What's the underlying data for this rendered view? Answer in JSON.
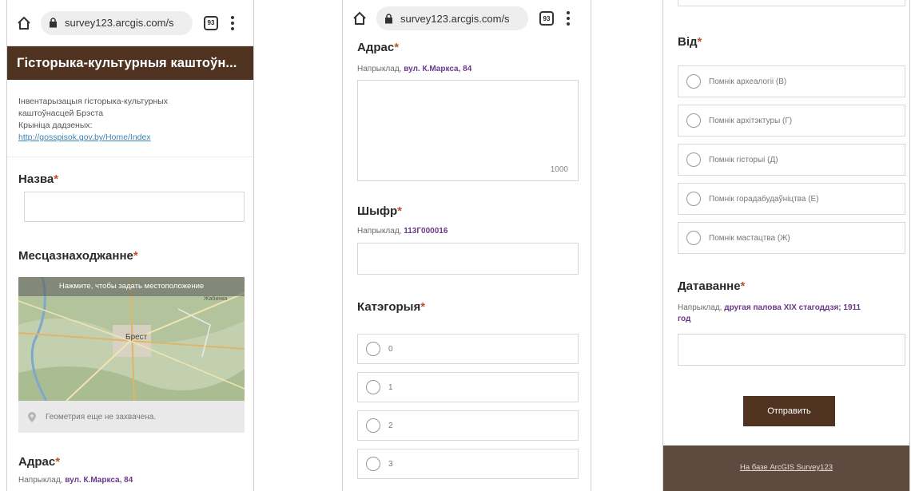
{
  "browser": {
    "url": "survey123.arcgis.com/s",
    "tab_count": "93"
  },
  "form": {
    "title": "Гісторыка-культурныя каштоўн...",
    "description_lines": [
      "Інвентарызацыя гісторыка-культурных",
      "каштоўнасцей Брэста",
      "Крыніца дадзеных:"
    ],
    "source_link": "http://gosspisok.gov.by/Home/Index",
    "required_mark": "*"
  },
  "questions": {
    "name": {
      "label": "Назва",
      "value": ""
    },
    "location": {
      "label": "Месцазнаходжанне",
      "map_banner": "Нажмите, чтобы задать местоположение",
      "map_city": "Брест",
      "map_town": "Жабинка",
      "geometry_status": "Геометрия еще не захвачена."
    },
    "address": {
      "label": "Адрас",
      "hint_prefix": "Напрыклад,",
      "hint_example": "вул. К.Маркса, 84",
      "char_limit": "1000",
      "value": ""
    },
    "code": {
      "label": "Шыфр",
      "hint_prefix": "Напрыклад,",
      "hint_example": "113Г000016",
      "value": ""
    },
    "category": {
      "label": "Катэгорыя",
      "options": [
        "0",
        "1",
        "2",
        "3"
      ],
      "selected": null
    },
    "type": {
      "label": "Від",
      "options": [
        "Помнік археалогіі (В)",
        "Помнік архітэктуры (Г)",
        "Помнік гісторыі (Д)",
        "Помнік горадабудаўніцтва (Е)",
        "Помнік мастацтва (Ж)"
      ],
      "selected": null
    },
    "dating": {
      "label": "Датаванне",
      "hint_prefix": "Напрыклад,",
      "hint_example_line1": "другая палова XIX стагоддзя; 1911",
      "hint_example_line2": "год",
      "value": ""
    }
  },
  "actions": {
    "submit_label": "Отправить"
  },
  "footer": {
    "text": "На базе ArcGIS Survey123"
  },
  "colors": {
    "brand_brown": "#4f3320",
    "required_red": "#b9532f",
    "hint_purple": "#6a3a8a",
    "link_blue": "#3a84b8"
  }
}
